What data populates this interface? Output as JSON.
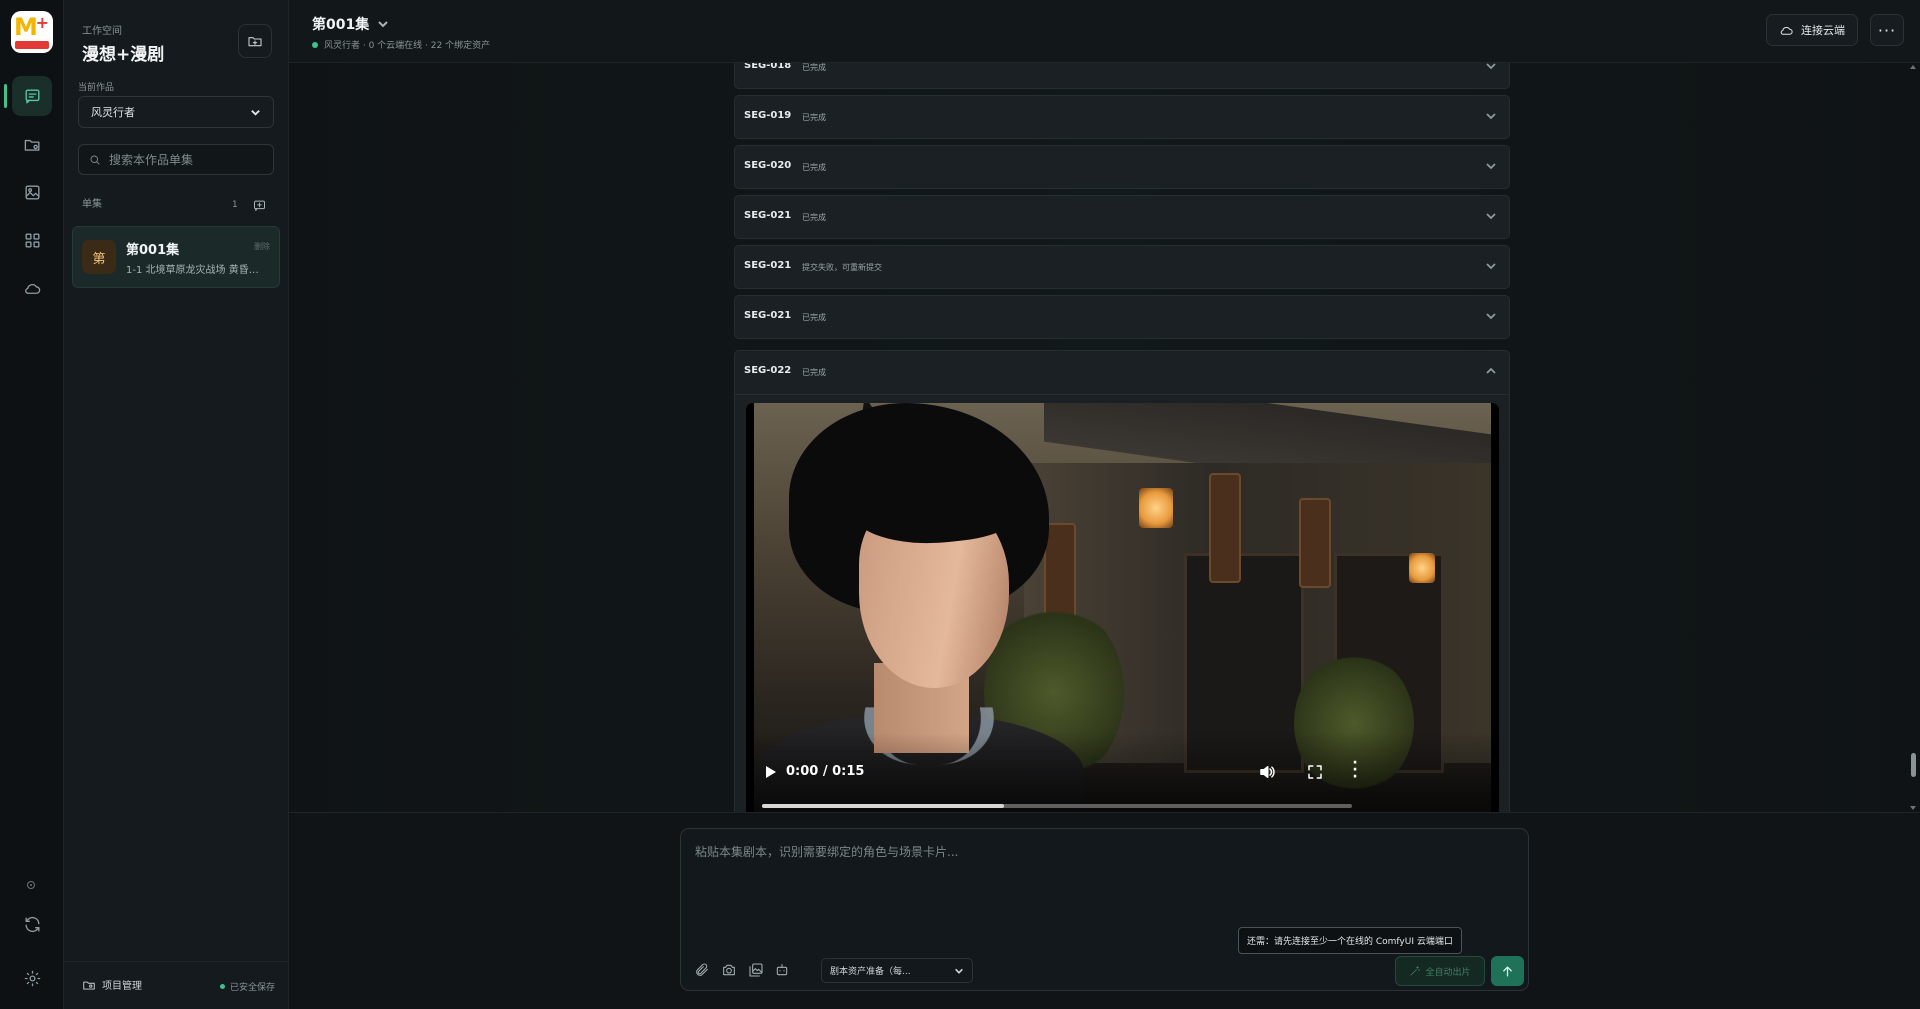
{
  "app": {
    "logo_text": "漫想+",
    "workspace_caption": "工作空间",
    "workspace_title": "漫想+漫剧"
  },
  "rail": {
    "items": [
      {
        "name": "chat",
        "icon": "chat-icon",
        "active": true
      },
      {
        "name": "assets",
        "icon": "folder-settings-icon",
        "active": false
      },
      {
        "name": "images",
        "icon": "image-icon",
        "active": false
      },
      {
        "name": "apps",
        "icon": "grid-icon",
        "active": false
      },
      {
        "name": "cloud",
        "icon": "cloud-icon",
        "active": false
      }
    ],
    "bottom": [
      {
        "name": "status",
        "icon": "status-dot-icon"
      },
      {
        "name": "sync",
        "icon": "refresh-icon"
      },
      {
        "name": "settings",
        "icon": "gear-icon"
      }
    ]
  },
  "sidebar": {
    "current_work_caption": "当前作品",
    "current_work": "风灵行者",
    "search_placeholder": "搜索本作品单集",
    "episodes_caption": "单集",
    "episodes_count": "1",
    "episodes": [
      {
        "avatar": "第",
        "name": "第001集",
        "delete_label": "删除",
        "desc": "1-1 北境草原龙灾战场 黄昏…",
        "active": true
      }
    ],
    "footer": {
      "project_manage": "项目管理",
      "save_status": "已安全保存"
    }
  },
  "topbar": {
    "episode_title": "第001集",
    "status": "风灵行者 · 0 个云端在线 · 22 个绑定资产",
    "connect_cloud": "连接云端"
  },
  "segments": [
    {
      "id": "SEG-018",
      "status": "已完成",
      "expanded": false
    },
    {
      "id": "SEG-019",
      "status": "已完成",
      "expanded": false
    },
    {
      "id": "SEG-020",
      "status": "已完成",
      "expanded": false
    },
    {
      "id": "SEG-021",
      "status": "已完成",
      "expanded": false
    },
    {
      "id": "SEG-021",
      "status": "提交失败，可重新提交",
      "expanded": false
    },
    {
      "id": "SEG-021",
      "status": "已完成",
      "expanded": false
    },
    {
      "id": "SEG-022",
      "status": "已完成",
      "expanded": true
    }
  ],
  "video": {
    "time": "0:00 / 0:15",
    "buffered_fraction": 0.41
  },
  "composer": {
    "placeholder": "粘贴本集剧本，识别需要绑定的角色与场景卡片...",
    "tooltip": "还需：请先连接至少一个在线的 ComfyUI 云端端口",
    "mode": "剧本资产准备（每...",
    "auto_button": "全自动出片"
  },
  "colors": {
    "accent": "#3ec18d",
    "background": "#101417",
    "panel": "#1a2024"
  }
}
